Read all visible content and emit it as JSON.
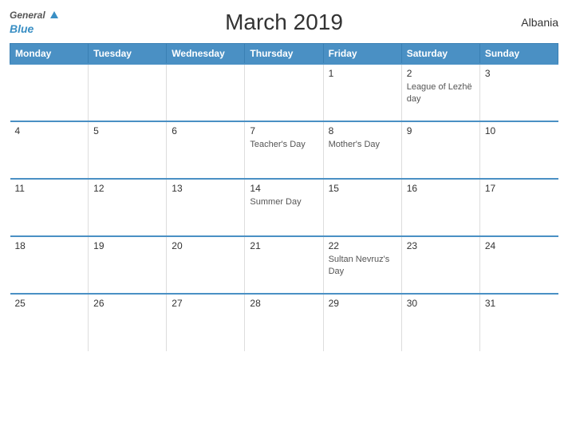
{
  "header": {
    "title": "March 2019",
    "country": "Albania",
    "logo_general": "General",
    "logo_blue": "Blue"
  },
  "days_of_week": [
    "Monday",
    "Tuesday",
    "Wednesday",
    "Thursday",
    "Friday",
    "Saturday",
    "Sunday"
  ],
  "weeks": [
    [
      {
        "day": "",
        "event": ""
      },
      {
        "day": "",
        "event": ""
      },
      {
        "day": "",
        "event": ""
      },
      {
        "day": "",
        "event": ""
      },
      {
        "day": "1",
        "event": ""
      },
      {
        "day": "2",
        "event": "League of Lezhë day"
      },
      {
        "day": "3",
        "event": ""
      }
    ],
    [
      {
        "day": "4",
        "event": ""
      },
      {
        "day": "5",
        "event": ""
      },
      {
        "day": "6",
        "event": ""
      },
      {
        "day": "7",
        "event": "Teacher's Day"
      },
      {
        "day": "8",
        "event": "Mother's Day"
      },
      {
        "day": "9",
        "event": ""
      },
      {
        "day": "10",
        "event": ""
      }
    ],
    [
      {
        "day": "11",
        "event": ""
      },
      {
        "day": "12",
        "event": ""
      },
      {
        "day": "13",
        "event": ""
      },
      {
        "day": "14",
        "event": "Summer Day"
      },
      {
        "day": "15",
        "event": ""
      },
      {
        "day": "16",
        "event": ""
      },
      {
        "day": "17",
        "event": ""
      }
    ],
    [
      {
        "day": "18",
        "event": ""
      },
      {
        "day": "19",
        "event": ""
      },
      {
        "day": "20",
        "event": ""
      },
      {
        "day": "21",
        "event": ""
      },
      {
        "day": "22",
        "event": "Sultan Nevruz's Day"
      },
      {
        "day": "23",
        "event": ""
      },
      {
        "day": "24",
        "event": ""
      }
    ],
    [
      {
        "day": "25",
        "event": ""
      },
      {
        "day": "26",
        "event": ""
      },
      {
        "day": "27",
        "event": ""
      },
      {
        "day": "28",
        "event": ""
      },
      {
        "day": "29",
        "event": ""
      },
      {
        "day": "30",
        "event": ""
      },
      {
        "day": "31",
        "event": ""
      }
    ]
  ],
  "colors": {
    "header_bg": "#4a90c4",
    "border_top": "#4a90c4",
    "accent_blue": "#3a8fc4"
  }
}
